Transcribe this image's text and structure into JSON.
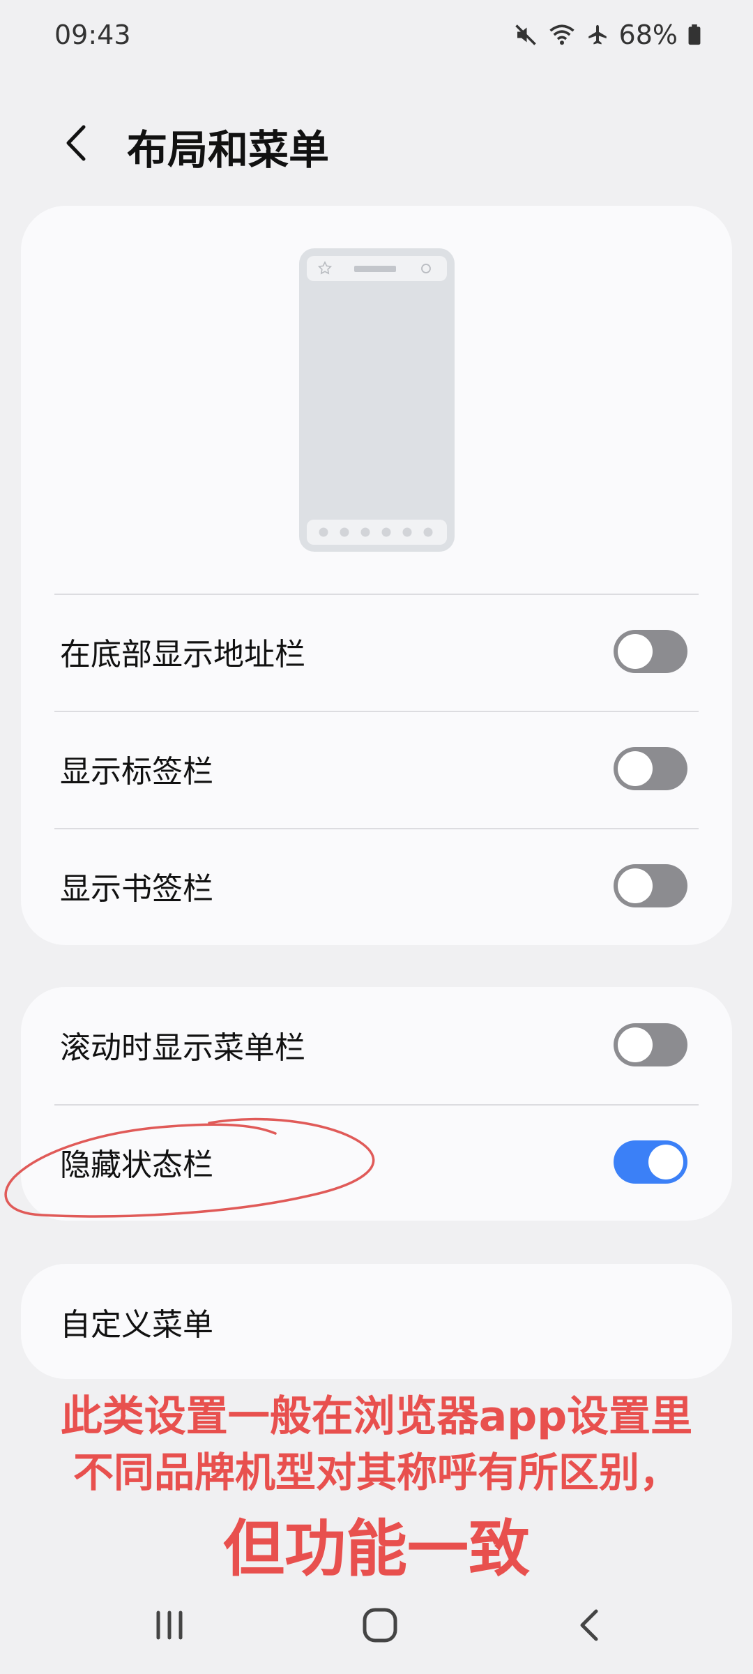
{
  "status_bar": {
    "time": "09:43",
    "battery": "68%",
    "icons": [
      "mute-icon",
      "wifi-icon",
      "airplane-icon",
      "battery-icon"
    ]
  },
  "header": {
    "title": "布局和菜单",
    "back_icon": "back-arrow-icon"
  },
  "layout_card": {
    "preview_icon": "phone-layout-preview-icon",
    "rows": [
      {
        "label": "在底部显示地址栏",
        "enabled": false
      },
      {
        "label": "显示标签栏",
        "enabled": false
      },
      {
        "label": "显示书签栏",
        "enabled": false
      }
    ]
  },
  "menu_card": {
    "rows": [
      {
        "label": "滚动时显示菜单栏",
        "enabled": false
      },
      {
        "label": "隐藏状态栏",
        "enabled": true
      }
    ]
  },
  "custom_menu": {
    "label": "自定义菜单"
  },
  "annotation": {
    "line1": "此类设置一般在浏览器app设置里",
    "line2": "不同品牌机型对其称呼有所区别，",
    "line3": "但功能一致",
    "color": "#e8504e"
  },
  "colors": {
    "toggle_on": "#3b80f7",
    "toggle_off": "#8c8c90",
    "background": "#f0f0f2",
    "card": "#fafafc"
  },
  "nav_bar": {
    "icons": [
      "recents-icon",
      "home-icon",
      "back-icon"
    ]
  }
}
